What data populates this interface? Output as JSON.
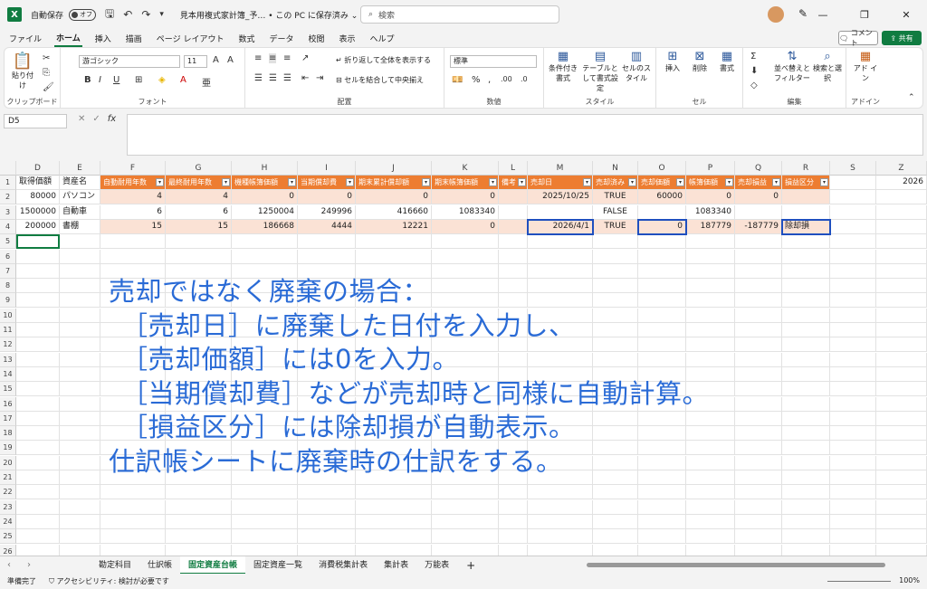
{
  "titlebar": {
    "app_icon": "X",
    "autosave_label": "自動保存",
    "autosave_state": "オフ",
    "doc_title": "見本用複式家計簿_予…  •  この PC に保存済み ⌄",
    "search_placeholder": "検索"
  },
  "menu": {
    "items": [
      "ファイル",
      "ホーム",
      "挿入",
      "描画",
      "ページ レイアウト",
      "数式",
      "データ",
      "校閲",
      "表示",
      "ヘルプ"
    ],
    "active": "ホーム",
    "comment_label": "コメント",
    "share_label": "共有"
  },
  "ribbon": {
    "clipboard": {
      "paste": "貼り付け",
      "label": "クリップボード"
    },
    "font": {
      "name": "游ゴシック",
      "size": "11",
      "label": "フォント"
    },
    "alignment": {
      "wrap": "折り返して全体を表示する",
      "merge": "セルを結合して中央揃え",
      "label": "配置"
    },
    "number": {
      "format": "標準",
      "label": "数値"
    },
    "styles": {
      "conditional": "条件付き書式",
      "table": "テーブルとして書式設定",
      "cell": "セルのスタイル",
      "label": "スタイル"
    },
    "cells": {
      "insert": "挿入",
      "delete": "削除",
      "format": "書式",
      "label": "セル"
    },
    "editing": {
      "sort": "並べ替えとフィルター",
      "find": "検索と選択",
      "label": "編集"
    },
    "addin": {
      "label": "アドイン",
      "btn": "アド イン"
    }
  },
  "formula": {
    "namebox": "D5",
    "fx": "fx",
    "content": ""
  },
  "grid": {
    "columns": [
      "D",
      "E",
      "F",
      "G",
      "H",
      "I",
      "J",
      "K",
      "L",
      "M",
      "N",
      "O",
      "P",
      "Q",
      "R",
      "S",
      "Z"
    ],
    "z1": "2026",
    "row1": [
      "取得価額",
      "資産名",
      "自動耐用年数",
      "最終耐用年数",
      "機種帳簿価額",
      "当期償却費",
      "期末累計償却額",
      "期末帳簿価額",
      "備考",
      "売却日",
      "売却済み",
      "売却価額",
      "帳簿価額",
      "売却損益",
      "損益区分"
    ],
    "row2": [
      "80000",
      "パソコン",
      "4",
      "4",
      "0",
      "0",
      "0",
      "0",
      "",
      "2025/10/25",
      "TRUE",
      "60000",
      "0",
      "0",
      ""
    ],
    "row3": [
      "1500000",
      "自動車",
      "6",
      "6",
      "1250004",
      "249996",
      "416660",
      "1083340",
      "",
      "",
      "FALSE",
      "",
      "1083340",
      "",
      ""
    ],
    "row4": [
      "200000",
      "書棚",
      "15",
      "15",
      "186668",
      "4444",
      "12221",
      "0",
      "",
      "2026/4/1",
      "TRUE",
      "0",
      "187779",
      "-187779",
      "除却損"
    ],
    "row_numbers": [
      "1",
      "2",
      "3",
      "4",
      "5",
      "6",
      "7",
      "8",
      "9",
      "10",
      "11",
      "12",
      "13",
      "14",
      "15",
      "16",
      "17",
      "18",
      "19",
      "20",
      "21",
      "22",
      "23",
      "24",
      "25",
      "26"
    ]
  },
  "overlay": {
    "lines": [
      "売却ではなく廃棄の場合：",
      "［売却日］に廃棄した日付を入力し、",
      "［売却価額］には0を入力。",
      "［当期償却費］などが売却時と同様に自動計算。",
      "［損益区分］には除却損が自動表示。",
      "仕訳帳シートに廃棄時の仕訳をする。"
    ]
  },
  "sheets": {
    "tabs": [
      "勘定科目",
      "仕訳帳",
      "固定資産台帳",
      "固定資産一覧",
      "消費税集計表",
      "集計表",
      "万能表"
    ],
    "active": "固定資産台帳"
  },
  "status": {
    "ready": "準備完了",
    "accessibility": "アクセシビリティ: 検討が必要です",
    "zoom": "100%"
  }
}
